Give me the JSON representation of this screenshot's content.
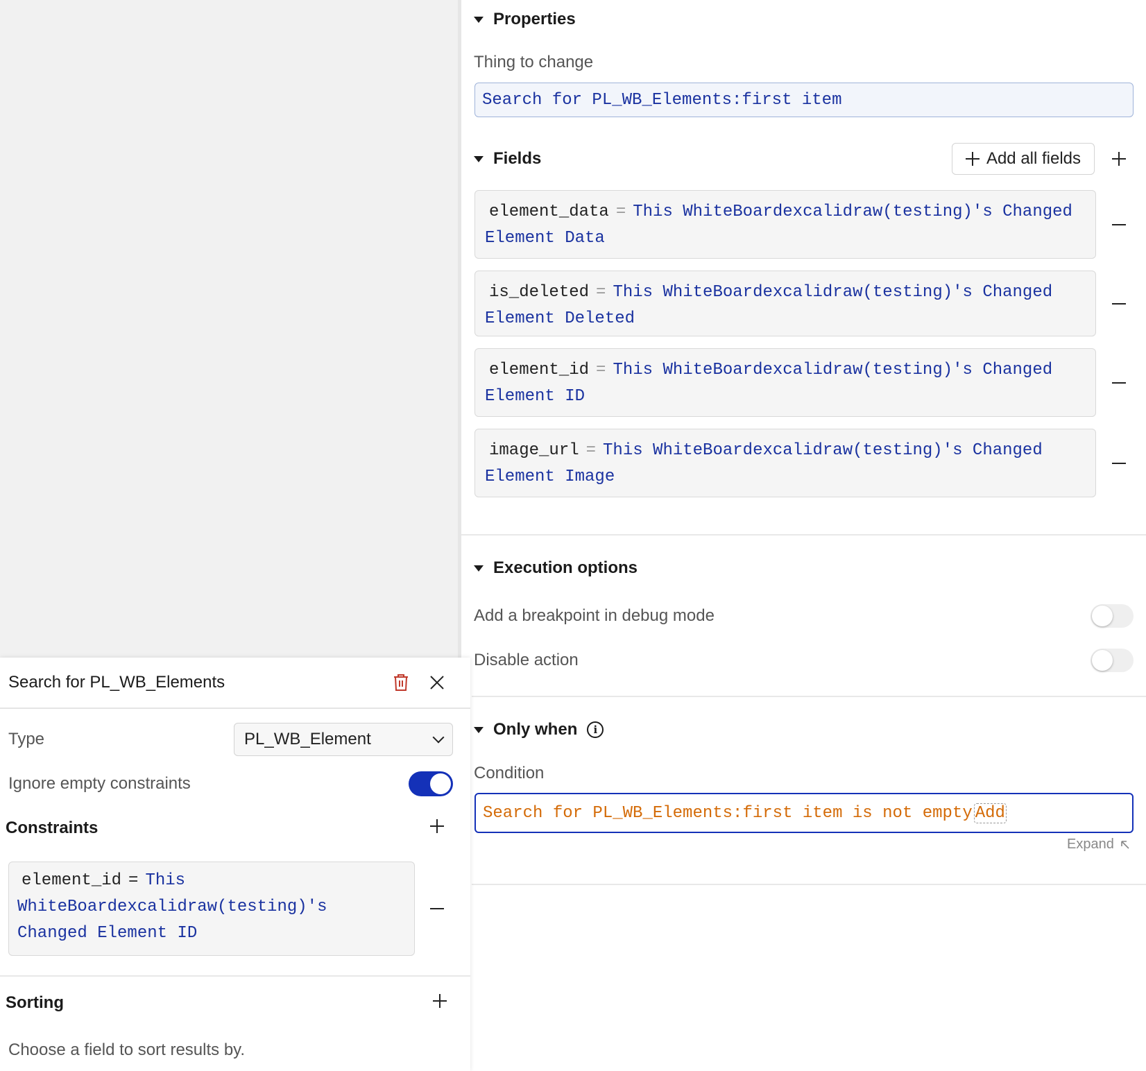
{
  "properties": {
    "header": "Properties",
    "thing_label": "Thing to change",
    "thing_value": "Search for PL_WB_Elements:first item"
  },
  "fields": {
    "header": "Fields",
    "add_all_label": "Add all fields",
    "items": [
      {
        "name": "element_data",
        "value": "This WhiteBoardexcalidraw(testing)'s Changed Element Data"
      },
      {
        "name": "is_deleted",
        "value": "This WhiteBoardexcalidraw(testing)'s Changed Element Deleted"
      },
      {
        "name": "element_id",
        "value": "This WhiteBoardexcalidraw(testing)'s Changed Element ID"
      },
      {
        "name": "image_url",
        "value": "This WhiteBoardexcalidraw(testing)'s Changed Element Image"
      }
    ]
  },
  "execution": {
    "header": "Execution options",
    "breakpoint_label": "Add a breakpoint in debug mode",
    "disable_label": "Disable action",
    "breakpoint_on": false,
    "disable_on": false
  },
  "only_when": {
    "header": "Only when",
    "condition_label": "Condition",
    "condition_value": "Search for PL_WB_Elements:first item is not empty",
    "add_label": "Add",
    "expand_label": "Expand"
  },
  "popup": {
    "title": "Search for PL_WB_Elements",
    "type_label": "Type",
    "type_value": "PL_WB_Element",
    "ignore_label": "Ignore empty constraints",
    "ignore_on": true,
    "constraints_header": "Constraints",
    "constraint": {
      "name": "element_id",
      "value": "This WhiteBoardexcalidraw(testing)'s Changed Element ID"
    },
    "sorting_header": "Sorting",
    "sorting_hint": "Choose a field to sort results by."
  },
  "colors": {
    "accent": "#1431b8",
    "dynamic_text": "#1a32a0",
    "condition_text": "#d46b08",
    "delete_icon": "#c0392b"
  }
}
